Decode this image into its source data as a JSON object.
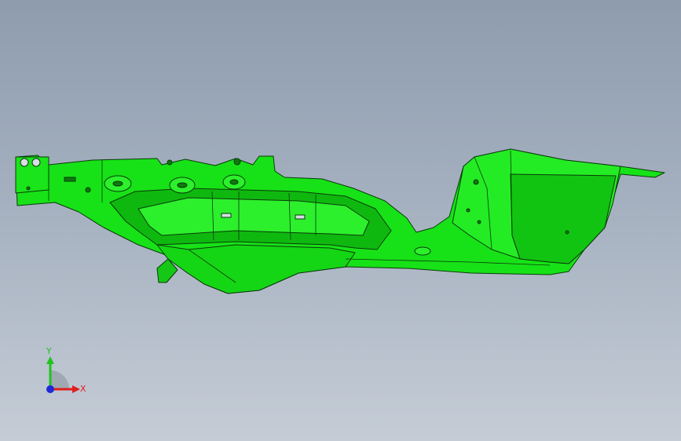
{
  "viewport": {
    "background_top": "#8e9cae",
    "background_bottom": "#c5ccd6"
  },
  "model": {
    "part_color": "#17e217",
    "edge_color": "#0a3a0a",
    "shade_color": "#0fb80f"
  },
  "triad": {
    "x_label": "X",
    "y_label": "Y",
    "x_color": "#e0201c",
    "y_color": "#1fc41f",
    "z_color": "#1e2ad8"
  }
}
